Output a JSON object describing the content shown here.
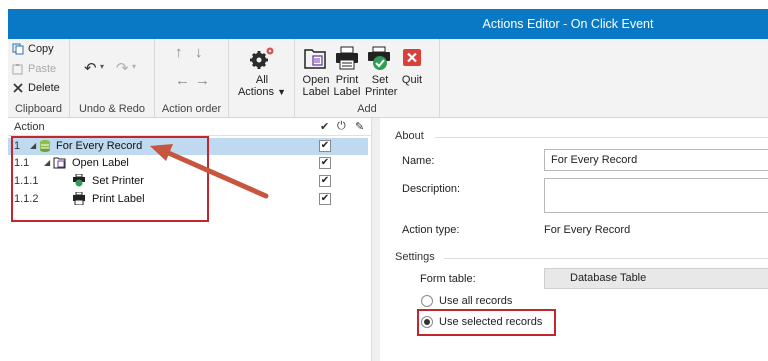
{
  "window": {
    "title": "Actions Editor - On Click Event"
  },
  "ribbon": {
    "clipboard": {
      "copy": "Copy",
      "paste": "Paste",
      "delete": "Delete",
      "label": "Clipboard"
    },
    "undo_redo": {
      "label": "Undo & Redo"
    },
    "action_order": {
      "label": "Action order"
    },
    "all_actions": {
      "line1": "All",
      "line2": "Actions"
    },
    "add": {
      "open_label": [
        "Open",
        "Label"
      ],
      "print_label": [
        "Print",
        "Label"
      ],
      "set_printer": [
        "Set",
        "Printer"
      ],
      "quit": "Quit",
      "label": "Add"
    }
  },
  "tree": {
    "header": "Action",
    "rows": [
      {
        "num": "1",
        "label": "For Every Record",
        "checked": true,
        "selected": true,
        "icon": "database-loop-icon"
      },
      {
        "num": "1.1",
        "label": "Open Label",
        "checked": true,
        "selected": false,
        "icon": "open-label-icon"
      },
      {
        "num": "1.1.1",
        "label": "Set Printer",
        "checked": true,
        "selected": false,
        "icon": "set-printer-icon"
      },
      {
        "num": "1.1.2",
        "label": "Print Label",
        "checked": true,
        "selected": false,
        "icon": "printer-icon"
      }
    ]
  },
  "details": {
    "about_title": "About",
    "name_label": "Name:",
    "name_value": "For Every Record",
    "description_label": "Description:",
    "description_value": "",
    "action_type_label": "Action type:",
    "action_type_value": "For Every Record",
    "settings_title": "Settings",
    "form_table_label": "Form table:",
    "form_table_value": "Database Table",
    "radio_all": "Use all records",
    "radio_selected": "Use selected records",
    "selected_option": "selected"
  },
  "colors": {
    "titlebar": "#0a79c5",
    "highlight": "#c4262e",
    "selection": "#bfd9f0"
  }
}
